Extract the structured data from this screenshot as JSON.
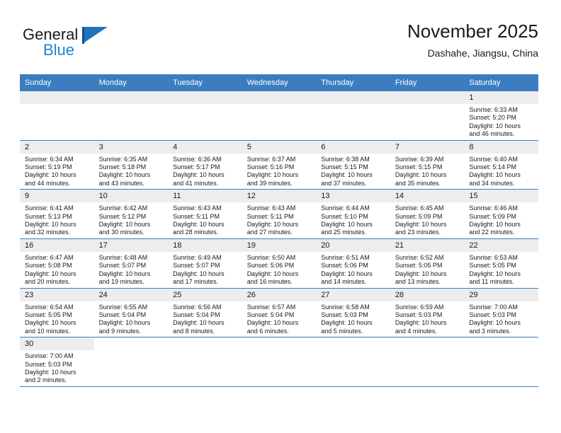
{
  "brand": {
    "word_one": "General",
    "word_two": "Blue",
    "flag_icon": "blue-flag-triangle"
  },
  "header": {
    "title": "November 2025",
    "subtitle": "Dashahe, Jiangsu, China"
  },
  "colors": {
    "header_blue": "#3b7dbf",
    "brand_blue": "#1f83d0",
    "daynum_bg": "#ededed",
    "text": "#1a1a1a"
  },
  "labels": {
    "sunrise_prefix": "Sunrise:",
    "sunset_prefix": "Sunset:",
    "daylight_prefix": "Daylight:"
  },
  "weekdays": [
    "Sunday",
    "Monday",
    "Tuesday",
    "Wednesday",
    "Thursday",
    "Friday",
    "Saturday"
  ],
  "weeks": [
    [
      {
        "day": "",
        "blank": true
      },
      {
        "day": "",
        "blank": true
      },
      {
        "day": "",
        "blank": true
      },
      {
        "day": "",
        "blank": true
      },
      {
        "day": "",
        "blank": true
      },
      {
        "day": "",
        "blank": true
      },
      {
        "day": "1",
        "sunrise": "Sunrise: 6:33 AM",
        "sunset": "Sunset: 5:20 PM",
        "daylight_line1": "Daylight: 10 hours",
        "daylight_line2": "and 46 minutes."
      }
    ],
    [
      {
        "day": "2",
        "sunrise": "Sunrise: 6:34 AM",
        "sunset": "Sunset: 5:19 PM",
        "daylight_line1": "Daylight: 10 hours",
        "daylight_line2": "and 44 minutes."
      },
      {
        "day": "3",
        "sunrise": "Sunrise: 6:35 AM",
        "sunset": "Sunset: 5:18 PM",
        "daylight_line1": "Daylight: 10 hours",
        "daylight_line2": "and 43 minutes."
      },
      {
        "day": "4",
        "sunrise": "Sunrise: 6:36 AM",
        "sunset": "Sunset: 5:17 PM",
        "daylight_line1": "Daylight: 10 hours",
        "daylight_line2": "and 41 minutes."
      },
      {
        "day": "5",
        "sunrise": "Sunrise: 6:37 AM",
        "sunset": "Sunset: 5:16 PM",
        "daylight_line1": "Daylight: 10 hours",
        "daylight_line2": "and 39 minutes."
      },
      {
        "day": "6",
        "sunrise": "Sunrise: 6:38 AM",
        "sunset": "Sunset: 5:15 PM",
        "daylight_line1": "Daylight: 10 hours",
        "daylight_line2": "and 37 minutes."
      },
      {
        "day": "7",
        "sunrise": "Sunrise: 6:39 AM",
        "sunset": "Sunset: 5:15 PM",
        "daylight_line1": "Daylight: 10 hours",
        "daylight_line2": "and 35 minutes."
      },
      {
        "day": "8",
        "sunrise": "Sunrise: 6:40 AM",
        "sunset": "Sunset: 5:14 PM",
        "daylight_line1": "Daylight: 10 hours",
        "daylight_line2": "and 34 minutes."
      }
    ],
    [
      {
        "day": "9",
        "sunrise": "Sunrise: 6:41 AM",
        "sunset": "Sunset: 5:13 PM",
        "daylight_line1": "Daylight: 10 hours",
        "daylight_line2": "and 32 minutes."
      },
      {
        "day": "10",
        "sunrise": "Sunrise: 6:42 AM",
        "sunset": "Sunset: 5:12 PM",
        "daylight_line1": "Daylight: 10 hours",
        "daylight_line2": "and 30 minutes."
      },
      {
        "day": "11",
        "sunrise": "Sunrise: 6:43 AM",
        "sunset": "Sunset: 5:11 PM",
        "daylight_line1": "Daylight: 10 hours",
        "daylight_line2": "and 28 minutes."
      },
      {
        "day": "12",
        "sunrise": "Sunrise: 6:43 AM",
        "sunset": "Sunset: 5:11 PM",
        "daylight_line1": "Daylight: 10 hours",
        "daylight_line2": "and 27 minutes."
      },
      {
        "day": "13",
        "sunrise": "Sunrise: 6:44 AM",
        "sunset": "Sunset: 5:10 PM",
        "daylight_line1": "Daylight: 10 hours",
        "daylight_line2": "and 25 minutes."
      },
      {
        "day": "14",
        "sunrise": "Sunrise: 6:45 AM",
        "sunset": "Sunset: 5:09 PM",
        "daylight_line1": "Daylight: 10 hours",
        "daylight_line2": "and 23 minutes."
      },
      {
        "day": "15",
        "sunrise": "Sunrise: 6:46 AM",
        "sunset": "Sunset: 5:09 PM",
        "daylight_line1": "Daylight: 10 hours",
        "daylight_line2": "and 22 minutes."
      }
    ],
    [
      {
        "day": "16",
        "sunrise": "Sunrise: 6:47 AM",
        "sunset": "Sunset: 5:08 PM",
        "daylight_line1": "Daylight: 10 hours",
        "daylight_line2": "and 20 minutes."
      },
      {
        "day": "17",
        "sunrise": "Sunrise: 6:48 AM",
        "sunset": "Sunset: 5:07 PM",
        "daylight_line1": "Daylight: 10 hours",
        "daylight_line2": "and 19 minutes."
      },
      {
        "day": "18",
        "sunrise": "Sunrise: 6:49 AM",
        "sunset": "Sunset: 5:07 PM",
        "daylight_line1": "Daylight: 10 hours",
        "daylight_line2": "and 17 minutes."
      },
      {
        "day": "19",
        "sunrise": "Sunrise: 6:50 AM",
        "sunset": "Sunset: 5:06 PM",
        "daylight_line1": "Daylight: 10 hours",
        "daylight_line2": "and 16 minutes."
      },
      {
        "day": "20",
        "sunrise": "Sunrise: 6:51 AM",
        "sunset": "Sunset: 5:06 PM",
        "daylight_line1": "Daylight: 10 hours",
        "daylight_line2": "and 14 minutes."
      },
      {
        "day": "21",
        "sunrise": "Sunrise: 6:52 AM",
        "sunset": "Sunset: 5:05 PM",
        "daylight_line1": "Daylight: 10 hours",
        "daylight_line2": "and 13 minutes."
      },
      {
        "day": "22",
        "sunrise": "Sunrise: 6:53 AM",
        "sunset": "Sunset: 5:05 PM",
        "daylight_line1": "Daylight: 10 hours",
        "daylight_line2": "and 11 minutes."
      }
    ],
    [
      {
        "day": "23",
        "sunrise": "Sunrise: 6:54 AM",
        "sunset": "Sunset: 5:05 PM",
        "daylight_line1": "Daylight: 10 hours",
        "daylight_line2": "and 10 minutes."
      },
      {
        "day": "24",
        "sunrise": "Sunrise: 6:55 AM",
        "sunset": "Sunset: 5:04 PM",
        "daylight_line1": "Daylight: 10 hours",
        "daylight_line2": "and 9 minutes."
      },
      {
        "day": "25",
        "sunrise": "Sunrise: 6:56 AM",
        "sunset": "Sunset: 5:04 PM",
        "daylight_line1": "Daylight: 10 hours",
        "daylight_line2": "and 8 minutes."
      },
      {
        "day": "26",
        "sunrise": "Sunrise: 6:57 AM",
        "sunset": "Sunset: 5:04 PM",
        "daylight_line1": "Daylight: 10 hours",
        "daylight_line2": "and 6 minutes."
      },
      {
        "day": "27",
        "sunrise": "Sunrise: 6:58 AM",
        "sunset": "Sunset: 5:03 PM",
        "daylight_line1": "Daylight: 10 hours",
        "daylight_line2": "and 5 minutes."
      },
      {
        "day": "28",
        "sunrise": "Sunrise: 6:59 AM",
        "sunset": "Sunset: 5:03 PM",
        "daylight_line1": "Daylight: 10 hours",
        "daylight_line2": "and 4 minutes."
      },
      {
        "day": "29",
        "sunrise": "Sunrise: 7:00 AM",
        "sunset": "Sunset: 5:03 PM",
        "daylight_line1": "Daylight: 10 hours",
        "daylight_line2": "and 3 minutes."
      }
    ],
    [
      {
        "day": "30",
        "sunrise": "Sunrise: 7:00 AM",
        "sunset": "Sunset: 5:03 PM",
        "daylight_line1": "Daylight: 10 hours",
        "daylight_line2": "and 2 minutes."
      },
      {
        "day": "",
        "empty": true
      },
      {
        "day": "",
        "empty": true
      },
      {
        "day": "",
        "empty": true
      },
      {
        "day": "",
        "empty": true
      },
      {
        "day": "",
        "empty": true
      },
      {
        "day": "",
        "empty": true
      }
    ]
  ]
}
